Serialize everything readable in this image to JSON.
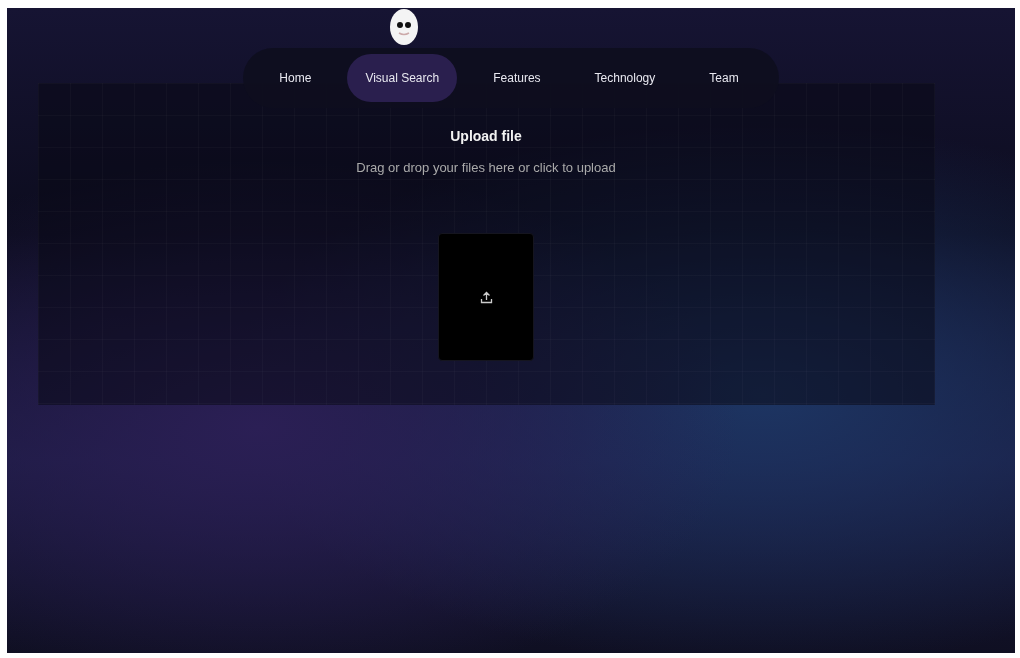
{
  "nav": {
    "items": [
      {
        "label": "Home",
        "selected": false
      },
      {
        "label": "Visual Search",
        "selected": true
      },
      {
        "label": "Features",
        "selected": false
      },
      {
        "label": "Technology",
        "selected": false
      },
      {
        "label": "Team",
        "selected": false
      }
    ]
  },
  "upload": {
    "title": "Upload file",
    "subtitle": "Drag or drop your files here or click to upload"
  }
}
